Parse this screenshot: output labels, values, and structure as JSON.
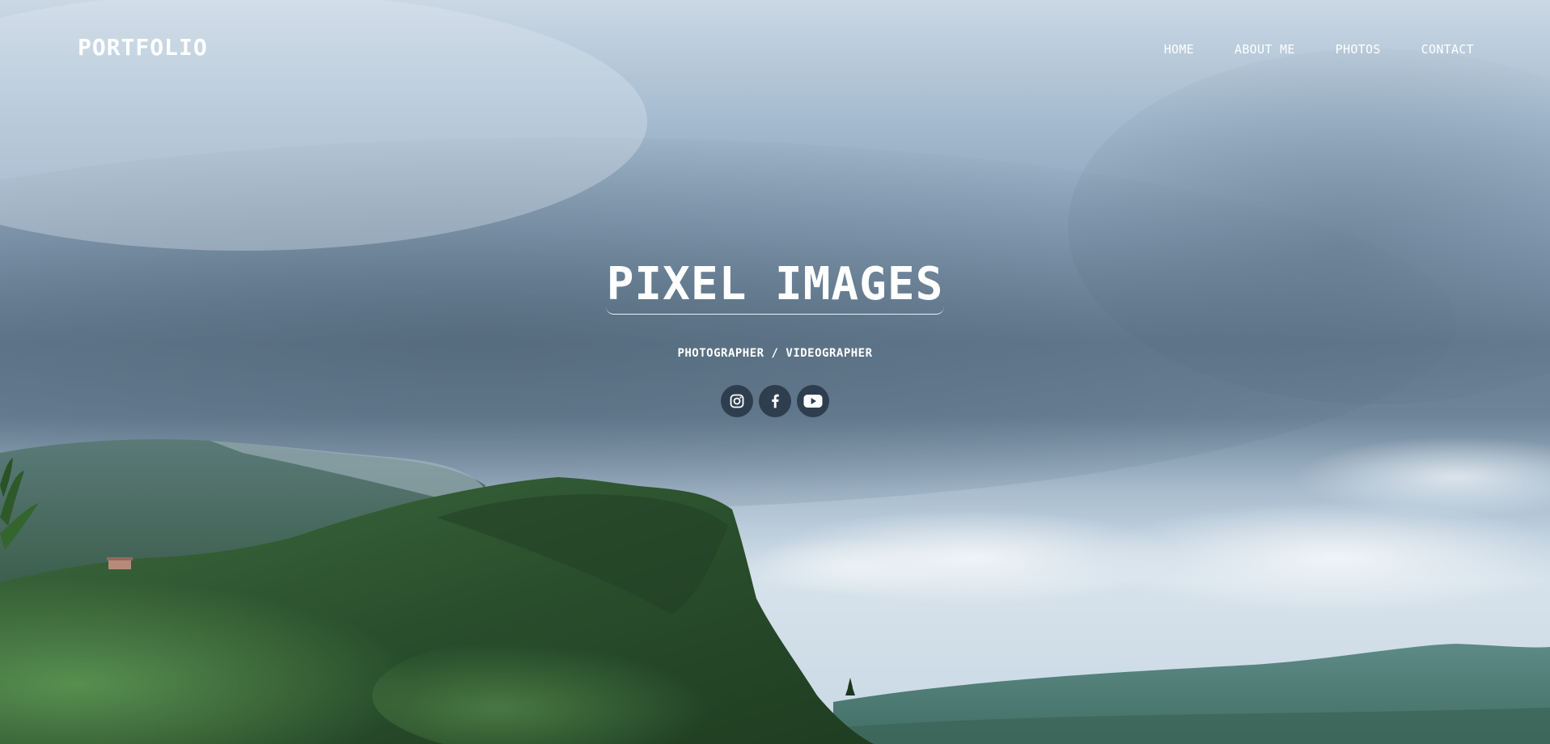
{
  "brand": {
    "logo": "PORTFOLIO"
  },
  "nav": {
    "items": [
      {
        "label": "HOME"
      },
      {
        "label": "ABOUT ME"
      },
      {
        "label": "PHOTOS"
      },
      {
        "label": "CONTACT"
      }
    ]
  },
  "hero": {
    "title": "PIXEL IMAGES",
    "subtitle": "PHOTOGRAPHER / VIDEOGRAPHER",
    "social": [
      {
        "icon": "instagram-icon"
      },
      {
        "icon": "facebook-icon"
      },
      {
        "icon": "youtube-icon"
      }
    ]
  },
  "colors": {
    "text": "#ffffff",
    "social_button_bg": "#2f3e4e",
    "sky_top": "#c9d6e2",
    "sky_dark": "#5d7286",
    "hill_green": "#2f5a34"
  }
}
